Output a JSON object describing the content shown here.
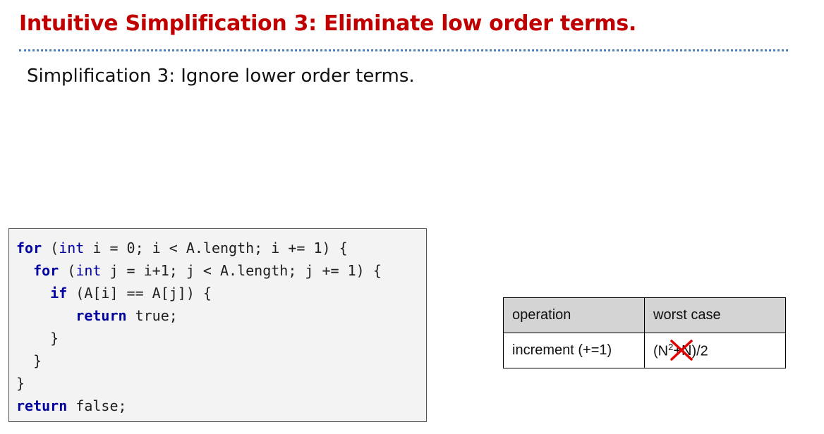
{
  "title": "Intuitive Simplification 3: Eliminate low order terms.",
  "subtitle": "Simplification 3: Ignore lower order terms.",
  "code": {
    "lines": [
      [
        {
          "t": "for",
          "c": "kw"
        },
        {
          "t": " ("
        },
        {
          "t": "int",
          "c": "tp"
        },
        {
          "t": " i = 0; i < A.length; i += 1) {"
        }
      ],
      [
        {
          "t": "  "
        },
        {
          "t": "for",
          "c": "kw"
        },
        {
          "t": " ("
        },
        {
          "t": "int",
          "c": "tp"
        },
        {
          "t": " j = i+1; j < A.length; j += 1) {"
        }
      ],
      [
        {
          "t": "    "
        },
        {
          "t": "if",
          "c": "kw"
        },
        {
          "t": " (A[i] == A[j]) {"
        }
      ],
      [
        {
          "t": "       "
        },
        {
          "t": "return",
          "c": "kw"
        },
        {
          "t": " true;"
        }
      ],
      [
        {
          "t": "    }"
        }
      ],
      [
        {
          "t": "  }"
        }
      ],
      [
        {
          "t": "}"
        }
      ],
      [
        {
          "t": "return",
          "c": "kw"
        },
        {
          "t": " false;"
        }
      ]
    ]
  },
  "table": {
    "header": [
      "operation",
      "worst case"
    ],
    "row": {
      "operation": "increment (+=1)",
      "cost_prefix": "(N",
      "cost_exp": "2",
      "cost_struck": "+N",
      "cost_suffix": ")/2"
    }
  },
  "colors": {
    "title": "#c00000",
    "rule": "#4f81bd",
    "keyword": "#0000a0",
    "strike": "#e00000",
    "code_bg": "#f3f3f3",
    "table_header_bg": "#d4d4d4"
  }
}
